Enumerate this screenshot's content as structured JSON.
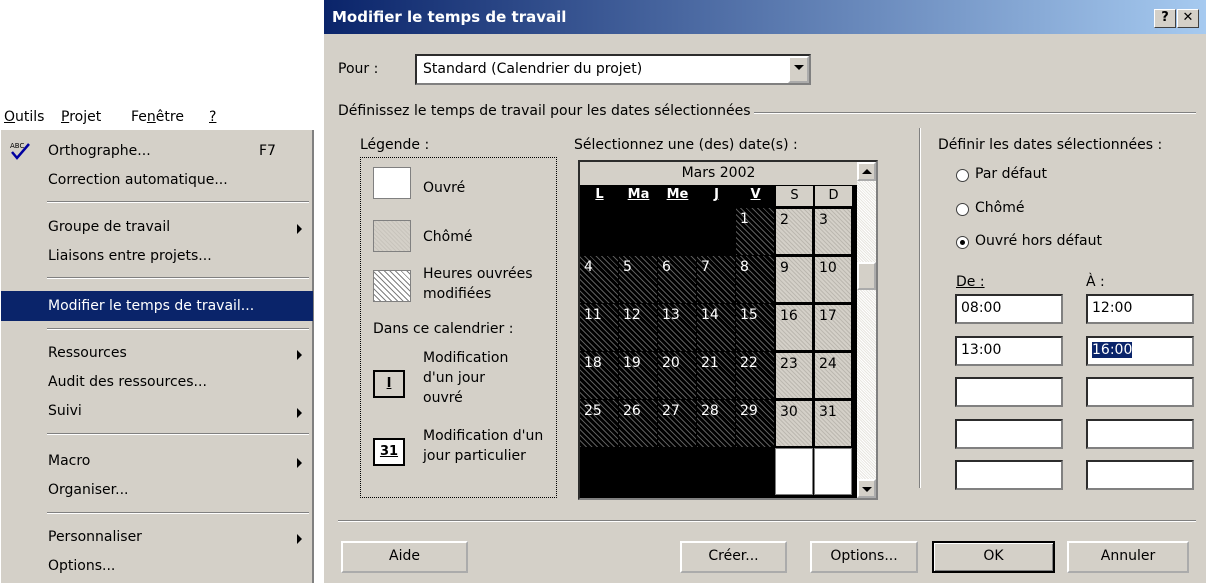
{
  "menubar": {
    "items": [
      "Outils",
      "Projet",
      "Fenêtre",
      "?"
    ]
  },
  "menu": {
    "items": [
      {
        "label": "Orthographe...",
        "shortcut": "F7",
        "icon": "spellcheck-icon"
      },
      {
        "label": "Correction automatique..."
      },
      {
        "label": "Groupe de travail",
        "submenu": true
      },
      {
        "label": "Liaisons entre projets..."
      },
      {
        "label": "Modifier le temps de travail...",
        "highlighted": true
      },
      {
        "label": "Ressources",
        "submenu": true
      },
      {
        "label": "Audit des ressources..."
      },
      {
        "label": "Suivi",
        "submenu": true
      },
      {
        "label": "Macro",
        "submenu": true
      },
      {
        "label": "Organiser..."
      },
      {
        "label": "Personnaliser",
        "submenu": true
      },
      {
        "label": "Options..."
      }
    ]
  },
  "dialog": {
    "title": "Modifier le temps de travail",
    "help_btn": "?",
    "close_btn": "✕",
    "pour_label": "Pour :",
    "pour_value": "Standard (Calendrier du projet)",
    "group_title": "Définissez le temps de travail pour les dates sélectionnées",
    "legend": {
      "title": "Légende :",
      "ouvre": "Ouvré",
      "chome": "Chômé",
      "heures_line1": "Heures ouvrées",
      "heures_line2": "modifiées",
      "dans_calendrier": "Dans ce calendrier :",
      "mod_jour_icon": "I",
      "mod_jour_1": "Modification",
      "mod_jour_2": "d'un jour",
      "mod_jour_3": "ouvré",
      "mod_part_icon": "31",
      "mod_part_1": "Modification d'un",
      "mod_part_2": "jour particulier"
    },
    "calendar": {
      "label": "Sélectionnez une (des) date(s) :",
      "month": "Mars 2002",
      "days_of_week": [
        "L",
        "Ma",
        "Me",
        "J",
        "V",
        "S",
        "D"
      ],
      "weeks": [
        [
          "",
          "",
          "",
          "",
          "1",
          "2",
          "3"
        ],
        [
          "4",
          "5",
          "6",
          "7",
          "8",
          "9",
          "10"
        ],
        [
          "11",
          "12",
          "13",
          "14",
          "15",
          "16",
          "17"
        ],
        [
          "18",
          "19",
          "20",
          "21",
          "22",
          "23",
          "24"
        ],
        [
          "25",
          "26",
          "27",
          "28",
          "29",
          "30",
          "31"
        ],
        [
          "",
          "",
          "",
          "",
          "",
          "",
          ""
        ]
      ]
    },
    "define": {
      "title": "Définir les dates sélectionnées :",
      "options": [
        "Par défaut",
        "Chômé",
        "Ouvré hors défaut"
      ],
      "selected_option": 2,
      "de_label": "De :",
      "a_label": "À :",
      "rows": [
        {
          "de": "08:00",
          "a": "12:00"
        },
        {
          "de": "13:00",
          "a": "16:00"
        },
        {
          "de": "",
          "a": ""
        },
        {
          "de": "",
          "a": ""
        },
        {
          "de": "",
          "a": ""
        }
      ]
    },
    "buttons": {
      "aide": "Aide",
      "creer": "Créer...",
      "options": "Options...",
      "ok": "OK",
      "annuler": "Annuler"
    }
  }
}
